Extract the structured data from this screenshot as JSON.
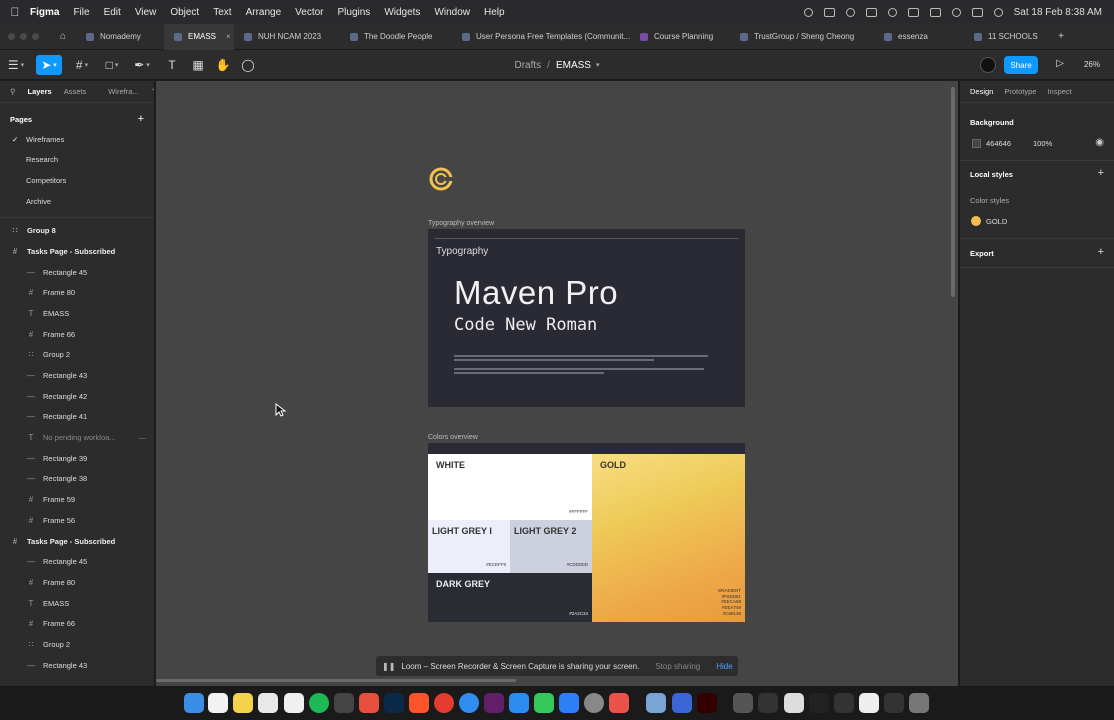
{
  "menubar": {
    "app_name": "Figma",
    "items": [
      "File",
      "Edit",
      "View",
      "Object",
      "Text",
      "Arrange",
      "Vector",
      "Plugins",
      "Widgets",
      "Window",
      "Help"
    ],
    "clock": "Sat 18 Feb  8:38 AM"
  },
  "tabs": [
    {
      "label": "Nomademy"
    },
    {
      "label": "EMASS",
      "active": true
    },
    {
      "label": "NUH NCAM 2023"
    },
    {
      "label": "The Doodle People"
    },
    {
      "label": "User Persona Free Templates (Communit..."
    },
    {
      "label": "Course Planning"
    },
    {
      "label": "TrustGroup / Sheng Cheong"
    },
    {
      "label": "essenza"
    },
    {
      "label": "11 SCHOOLS"
    }
  ],
  "toolbar": {
    "breadcrumb_root": "Drafts",
    "breadcrumb_sep": "/",
    "file_name": "EMASS",
    "share_label": "Share",
    "zoom": "26%"
  },
  "left_panel": {
    "tabs": [
      "Layers",
      "Assets",
      "Wirefra..."
    ],
    "pages_title": "Pages",
    "pages": [
      "Wireframes",
      "Research",
      "Competitors",
      "Archive"
    ],
    "layers": [
      {
        "label": "Group 8",
        "kind": "group",
        "level": "top"
      },
      {
        "label": "Tasks Page - Subscribed",
        "kind": "frame",
        "level": "top"
      },
      {
        "label": "Rectangle 45",
        "kind": "rect",
        "level": "child"
      },
      {
        "label": "Frame 80",
        "kind": "frame",
        "level": "child"
      },
      {
        "label": "EMASS",
        "kind": "text",
        "level": "child"
      },
      {
        "label": "Frame 66",
        "kind": "frame",
        "level": "child"
      },
      {
        "label": "Group 2",
        "kind": "group",
        "level": "child"
      },
      {
        "label": "Rectangle 43",
        "kind": "rect",
        "level": "child"
      },
      {
        "label": "Rectangle 42",
        "kind": "rect",
        "level": "child"
      },
      {
        "label": "Rectangle 41",
        "kind": "rect",
        "level": "child"
      },
      {
        "label": "No pending workloa...",
        "kind": "text",
        "level": "child",
        "muted": true
      },
      {
        "label": "Rectangle 39",
        "kind": "rect",
        "level": "child"
      },
      {
        "label": "Rectangle 38",
        "kind": "rect",
        "level": "child"
      },
      {
        "label": "Frame 59",
        "kind": "frame",
        "level": "child"
      },
      {
        "label": "Frame 56",
        "kind": "frame",
        "level": "child"
      },
      {
        "label": "Tasks Page - Subscribed",
        "kind": "frame",
        "level": "top"
      },
      {
        "label": "Rectangle 45",
        "kind": "rect",
        "level": "child"
      },
      {
        "label": "Frame 80",
        "kind": "frame",
        "level": "child"
      },
      {
        "label": "EMASS",
        "kind": "text",
        "level": "child"
      },
      {
        "label": "Frame 66",
        "kind": "frame",
        "level": "child"
      },
      {
        "label": "Group 2",
        "kind": "group",
        "level": "child"
      },
      {
        "label": "Rectangle 43",
        "kind": "rect",
        "level": "child"
      }
    ]
  },
  "canvas": {
    "typography_frame_label": "Typography overview",
    "typography_heading": "Typography",
    "font_primary": "Maven Pro",
    "font_secondary": "Code New Roman",
    "colors_frame_label": "Colors overview",
    "swatches": {
      "white": {
        "name": "WHITE",
        "hex": "#FFFFFF"
      },
      "light_grey_1": {
        "name": "LIGHT GREY I",
        "hex": "#ECEFF9"
      },
      "light_grey_2": {
        "name": "LIGHT GREY 2",
        "hex": "#CDD0DD"
      },
      "dark_grey": {
        "name": "DARK GREY",
        "hex": "#2A2C34"
      },
      "gold": {
        "name": "GOLD",
        "gradient_label": "GRADIENT",
        "stops": [
          "#F8DD81",
          "#EECA58",
          "#EEA748",
          "#C68136"
        ]
      }
    },
    "accent_gold": "#f2c14e"
  },
  "loom_banner": {
    "message": "Loom – Screen Recorder & Screen Capture is sharing your screen.",
    "stop_label": "Stop sharing",
    "hide_label": "Hide"
  },
  "help_label": "?",
  "right_panel": {
    "tabs": [
      "Design",
      "Prototype",
      "Inspect"
    ],
    "background_title": "Background",
    "background_hex": "464646",
    "background_opacity": "100%",
    "local_styles_title": "Local styles",
    "color_styles_title": "Color styles",
    "color_style_name": "GOLD",
    "export_title": "Export"
  }
}
